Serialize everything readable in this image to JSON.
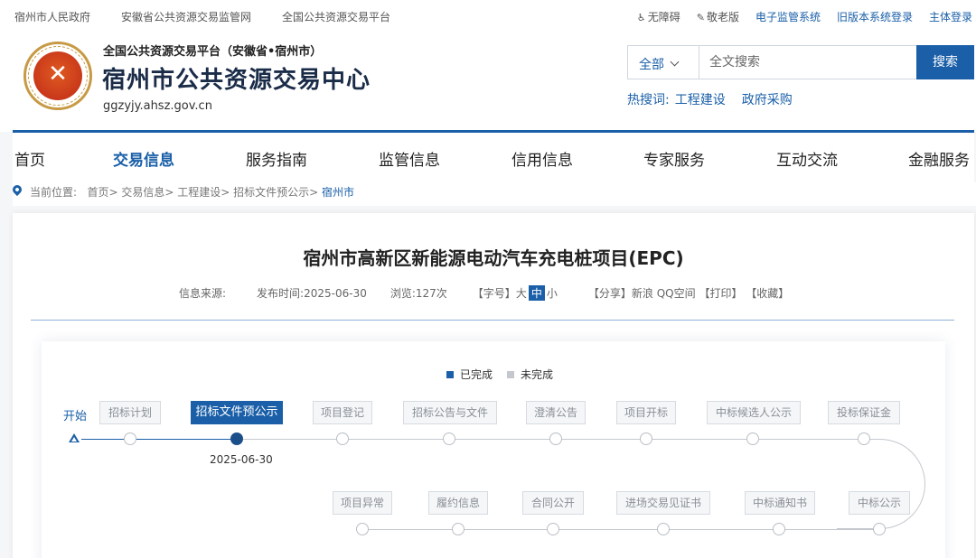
{
  "topbar": {
    "left_links": [
      "宿州市人民政府",
      "安徽省公共资源交易监管网",
      "全国公共资源交易平台"
    ],
    "right_links": [
      {
        "label": "无障碍",
        "icon": "accessibility-icon"
      },
      {
        "label": "敬老版",
        "icon": "elder-mode-icon"
      },
      {
        "label": "电子监管系统"
      },
      {
        "label": "旧版本系统登录"
      },
      {
        "label": "主体登录"
      }
    ]
  },
  "header": {
    "subtitle": "全国公共资源交易平台（安徽省•宿州市）",
    "title": "宿州市公共资源交易中心",
    "url": "ggzyjy.ahsz.gov.cn"
  },
  "search": {
    "scope": "全部",
    "placeholder": "全文搜索",
    "button": "搜索",
    "hot_label": "热搜词:",
    "hot_words": [
      "工程建设",
      "政府采购"
    ]
  },
  "nav": {
    "items": [
      "首页",
      "交易信息",
      "服务指南",
      "监管信息",
      "信用信息",
      "专家服务",
      "互动交流",
      "金融服务"
    ],
    "active": "交易信息"
  },
  "breadcrumb": {
    "prefix": "当前位置:",
    "path": "首页> 交易信息> 工程建设> 招标文件预公示>",
    "current": "宿州市"
  },
  "article": {
    "title": "宿州市高新区新能源电动汽车充电桩项目(EPC)",
    "source_label": "信息来源:",
    "publish_label": "发布时间:",
    "publish_date": "2025-06-30",
    "views_label": "浏览:",
    "views": "127次",
    "font_label": "【字号】",
    "font_sizes": [
      "大",
      "中",
      "小"
    ],
    "share_label": "【分享】",
    "share_targets": [
      "新浪",
      "QQ空间"
    ],
    "print": "【打印】",
    "favorite": "【收藏】"
  },
  "flow": {
    "legend_done": "已完成",
    "legend_todo": "未完成",
    "start": "开始",
    "row1": [
      "招标计划",
      "招标文件预公示",
      "项目登记",
      "招标公告与文件",
      "澄清公告",
      "项目开标",
      "中标候选人公示",
      "投标保证金"
    ],
    "row2": [
      "项目异常",
      "履约信息",
      "合同公开",
      "进场交易见证书",
      "中标通知书",
      "中标公示"
    ],
    "active_step": "招标文件预公示",
    "active_date": "2025-06-30"
  },
  "colors": {
    "accent": "#1a5fa8",
    "pending": "#c4c8ce"
  }
}
